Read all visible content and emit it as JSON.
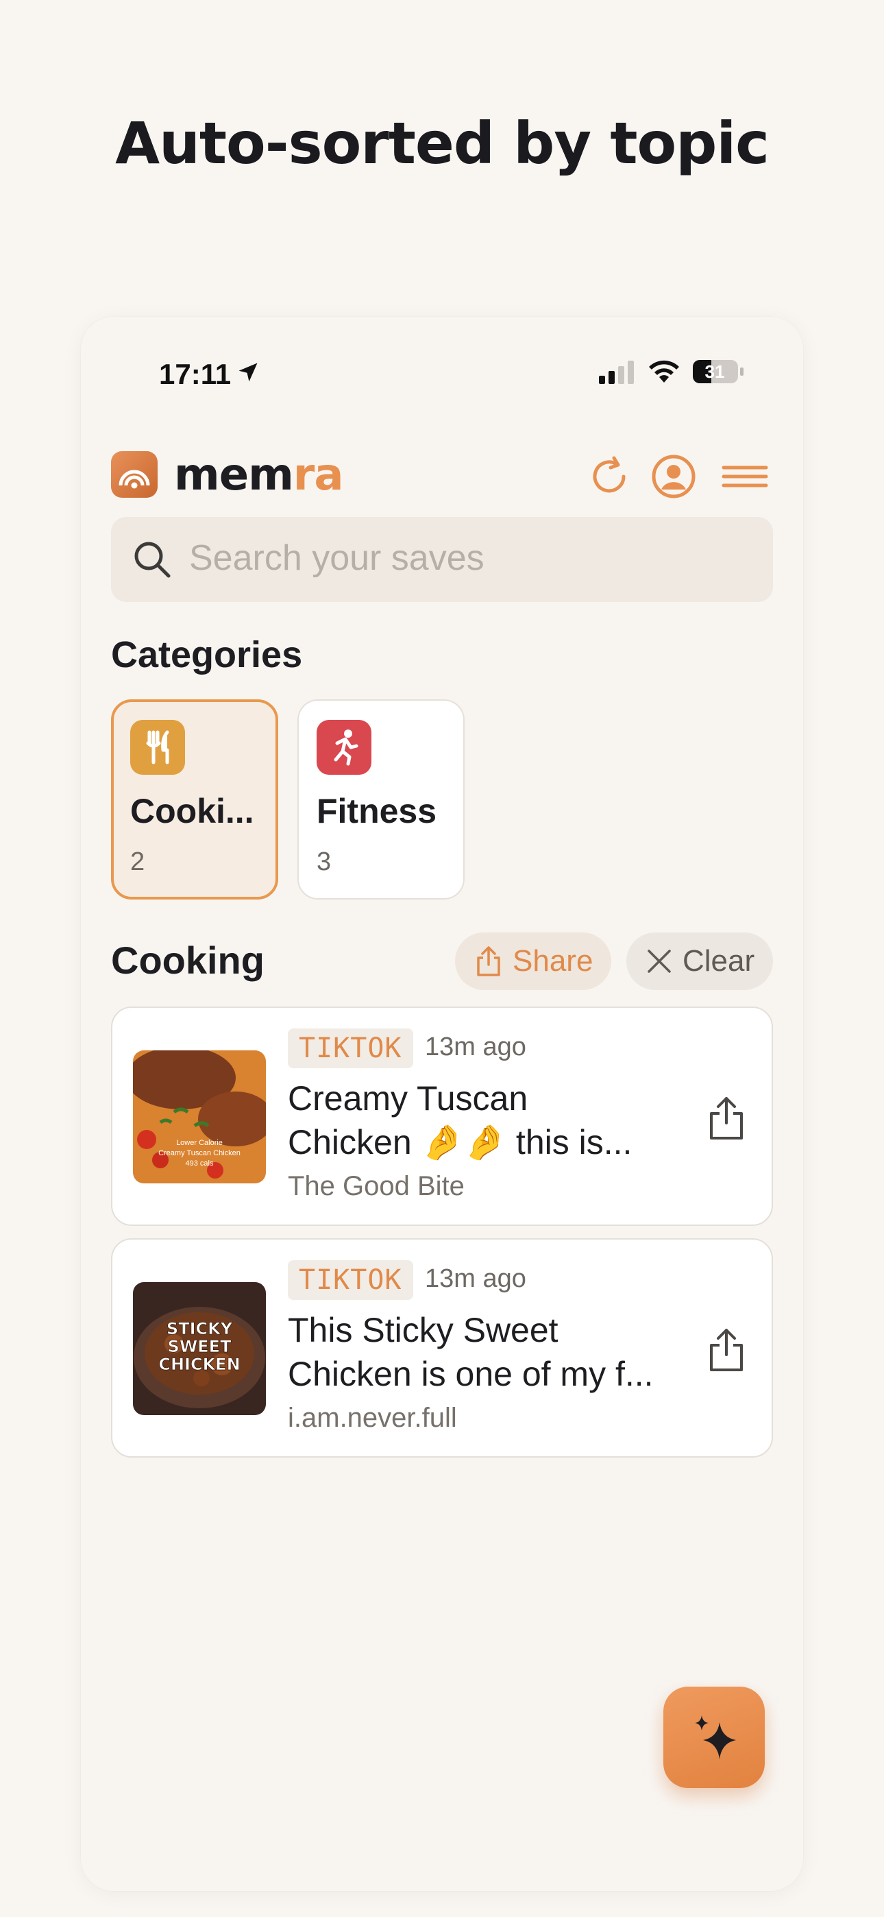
{
  "headline": "Auto-sorted by topic",
  "status_bar": {
    "time": "17:11",
    "battery": "31"
  },
  "app": {
    "name_part1": "mem",
    "name_part2": "ra"
  },
  "search": {
    "placeholder": "Search your saves"
  },
  "categories": {
    "title": "Categories",
    "items": [
      {
        "name": "Cooki...",
        "count": "2",
        "color": "#e0a040",
        "icon": "fork-knife-icon"
      },
      {
        "name": "Fitness",
        "count": "3",
        "color": "#d9474f",
        "icon": "runner-icon"
      }
    ]
  },
  "section": {
    "title": "Cooking",
    "share_label": "Share",
    "clear_label": "Clear"
  },
  "saves": [
    {
      "platform": "TIKTOK",
      "ago": "13m ago",
      "title_line1": "Creamy Tuscan",
      "title_line2": "Chicken 🤌🤌 this is...",
      "source": "The Good Bite",
      "thumb_text": [
        "Lower Calorie",
        "Creamy Tuscan Chicken",
        "493 cals"
      ]
    },
    {
      "platform": "TIKTOK",
      "ago": "13m ago",
      "title_line1": "This Sticky Sweet",
      "title_line2": "Chicken is one of my f...",
      "source": "i.am.never.full",
      "thumb_text": [
        "STICKY",
        "SWEET",
        "CHICKEN"
      ]
    }
  ],
  "colors": {
    "accent": "#e8904f",
    "background": "#f9f6f2"
  }
}
